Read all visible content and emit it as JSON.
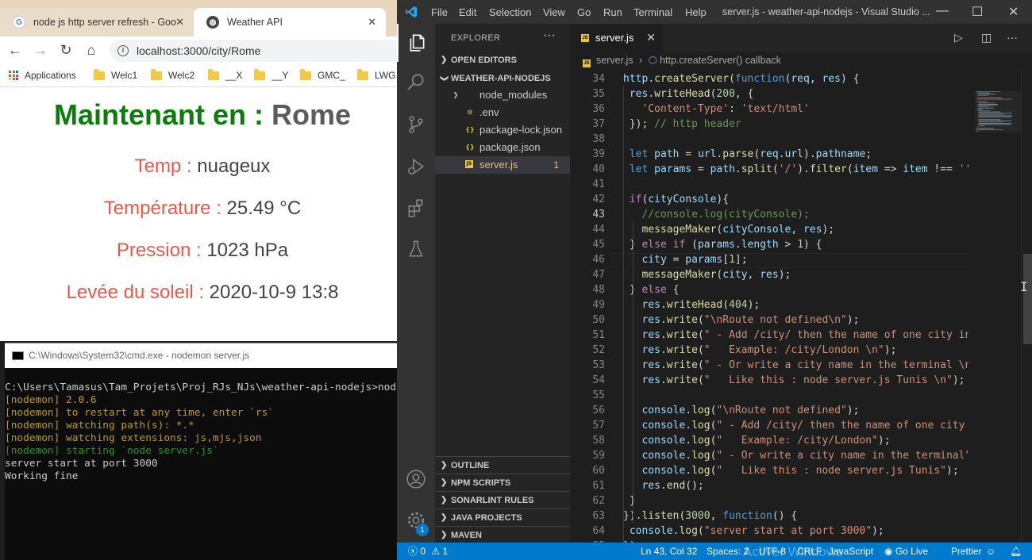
{
  "browser": {
    "tabs": [
      {
        "title": "node js http server refresh - Goo"
      },
      {
        "title": "Weather API"
      }
    ],
    "url": "localhost:3000/city/Rome",
    "bookmarks": [
      "Applications",
      "Welc1",
      "Welc2",
      "__X",
      "__Y",
      "GMC_",
      "LWG"
    ],
    "page": {
      "heading_prefix": "Maintenant en : ",
      "city": "Rome",
      "rows": [
        {
          "label": "Temp : ",
          "value": "nuageux"
        },
        {
          "label": "Température : ",
          "value": "25.49 °C"
        },
        {
          "label": "Pression : ",
          "value": "1023 hPa"
        },
        {
          "label": "Levée du soleil : ",
          "value": "2020-10-9 13:8"
        }
      ]
    }
  },
  "cmd": {
    "title": "C:\\Windows\\System32\\cmd.exe - nodemon  server.js",
    "lines": [
      {
        "text": "C:\\Users\\Tamasus\\Tam_Projets\\Proj_RJs_NJs\\weather-api-nodejs>nodemon server.js",
        "color": "white"
      },
      {
        "text": "[nodemon] 2.0.6",
        "color": "yellow"
      },
      {
        "text": "[nodemon] to restart at any time, enter `rs`",
        "color": "yellow"
      },
      {
        "text": "[nodemon] watching path(s): *.*",
        "color": "yellow"
      },
      {
        "text": "[nodemon] watching extensions: js,mjs,json",
        "color": "yellow"
      },
      {
        "text": "[nodemon] starting `node server.js`",
        "color": "green"
      },
      {
        "text": "server start at port 3000",
        "color": "white"
      },
      {
        "text": "Working fine",
        "color": "white"
      }
    ]
  },
  "vscode": {
    "menu": [
      "File",
      "Edit",
      "Selection",
      "View",
      "Go",
      "Run",
      "Terminal",
      "Help"
    ],
    "window_title": "server.js - weather-api-nodejs - Visual Studio ...",
    "explorer": {
      "header": "EXPLORER",
      "open_editors": "OPEN EDITORS",
      "project": "WEATHER-API-NODEJS",
      "files": [
        {
          "name": "node_modules",
          "kind": "folder"
        },
        {
          "name": ".env",
          "kind": "env"
        },
        {
          "name": "package-lock.json",
          "kind": "json"
        },
        {
          "name": "package.json",
          "kind": "json"
        },
        {
          "name": "server.js",
          "kind": "js",
          "selected": true,
          "count": "1"
        }
      ],
      "bottom_sections": [
        "OUTLINE",
        "NPM SCRIPTS",
        "SONARLINT RULES",
        "JAVA PROJECTS",
        "MAVEN"
      ]
    },
    "editor": {
      "tab": "server.js",
      "breadcrumb_file": "server.js",
      "breadcrumb_symbol": "http.createServer() callback",
      "lines": [
        {
          "n": "34",
          "c": "http.createServer(function(req, res) {"
        },
        {
          "n": "35",
          "c": " res.writeHead(200, {"
        },
        {
          "n": "36",
          "c": "   'Content-Type': 'text/html'"
        },
        {
          "n": "37",
          "c": " }); // http header"
        },
        {
          "n": "38",
          "c": ""
        },
        {
          "n": "39",
          "c": " let path = url.parse(req.url).pathname;"
        },
        {
          "n": "40",
          "c": " let params = path.split('/').filter(item => item !== ''"
        },
        {
          "n": "41",
          "c": ""
        },
        {
          "n": "42",
          "c": " if(cityConsole){"
        },
        {
          "n": "43",
          "c": "   //console.log(cityConsole);"
        },
        {
          "n": "44",
          "c": "   messageMaker(cityConsole, res);"
        },
        {
          "n": "45",
          "c": " } else if (params.length > 1) {"
        },
        {
          "n": "46",
          "c": "   city = params[1];"
        },
        {
          "n": "47",
          "c": "   messageMaker(city, res);"
        },
        {
          "n": "48",
          "c": " } else {"
        },
        {
          "n": "49",
          "c": "   res.writeHead(404);"
        },
        {
          "n": "50",
          "c": "   res.write(\"\\nRoute not defined\\n\");"
        },
        {
          "n": "51",
          "c": "   res.write(\" - Add /city/ then the name of one city in"
        },
        {
          "n": "52",
          "c": "   res.write(\"   Example: /city/London \\n\");"
        },
        {
          "n": "53",
          "c": "   res.write(\" - Or write a city name in the terminal \\n"
        },
        {
          "n": "54",
          "c": "   res.write(\"   Like this : node server.js Tunis \\n\");"
        },
        {
          "n": "55",
          "c": ""
        },
        {
          "n": "56",
          "c": "   console.log(\"\\nRoute not defined\");"
        },
        {
          "n": "57",
          "c": "   console.log(\" - Add /city/ then the name of one city"
        },
        {
          "n": "58",
          "c": "   console.log(\"   Example: /city/London\");"
        },
        {
          "n": "59",
          "c": "   console.log(\" - Or write a city name in the terminal\""
        },
        {
          "n": "60",
          "c": "   console.log(\"   Like this : node server.js Tunis\");"
        },
        {
          "n": "61",
          "c": "   res.end();"
        },
        {
          "n": "62",
          "c": " }"
        },
        {
          "n": "63",
          "c": "}).listen(3000, function() {"
        },
        {
          "n": "64",
          "c": " console.log(\"server start at port 3000\");"
        },
        {
          "n": "65",
          "c": "});"
        }
      ]
    },
    "statusbar": {
      "problems": "0",
      "warnings": "1",
      "position": "Ln 43, Col 32",
      "spaces": "Spaces: 2",
      "encoding": "UTF-8",
      "eol": "CRLF",
      "language": "JavaScript",
      "golive": "Go Live",
      "formatter": "Prettier",
      "watermark": "Activer Windows"
    },
    "accounts_badge": "1"
  },
  "colors": {
    "heading_green": "#0a7d0a",
    "label_red": "#e9594b",
    "vscode_blue": "#007acc",
    "selected_file": "#e2c08d"
  }
}
